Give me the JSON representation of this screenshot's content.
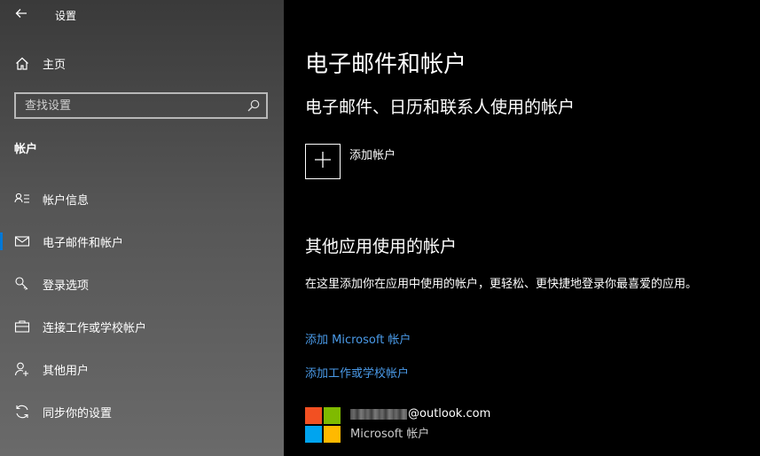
{
  "window": {
    "title": "设置"
  },
  "sidebar": {
    "home_label": "主页",
    "search_placeholder": "查找设置",
    "section_title": "帐户",
    "items": [
      {
        "label": "帐户信息",
        "icon": "account-info-icon"
      },
      {
        "label": "电子邮件和帐户",
        "icon": "mail-icon",
        "active": true
      },
      {
        "label": "登录选项",
        "icon": "key-icon"
      },
      {
        "label": "连接工作或学校帐户",
        "icon": "briefcase-icon"
      },
      {
        "label": "其他用户",
        "icon": "person-add-icon"
      },
      {
        "label": "同步你的设置",
        "icon": "sync-icon"
      }
    ]
  },
  "main": {
    "page_title": "电子邮件和帐户",
    "section1_title": "电子邮件、日历和联系人使用的帐户",
    "add_account_label": "添加帐户",
    "section2_title": "其他应用使用的帐户",
    "description": "在这里添加你在应用中使用的帐户，更轻松、更快捷地登录你最喜爱的应用。",
    "link_add_microsoft": "添加 Microsoft 帐户",
    "link_add_work": "添加工作或学校帐户",
    "account": {
      "email_suffix": "@outlook.com",
      "type": "Microsoft 帐户"
    }
  },
  "colors": {
    "accent": "#0078d7",
    "link": "#4a9ae8",
    "ms_red": "#f25022",
    "ms_green": "#7fba00",
    "ms_blue": "#00a4ef",
    "ms_yellow": "#ffb900"
  }
}
